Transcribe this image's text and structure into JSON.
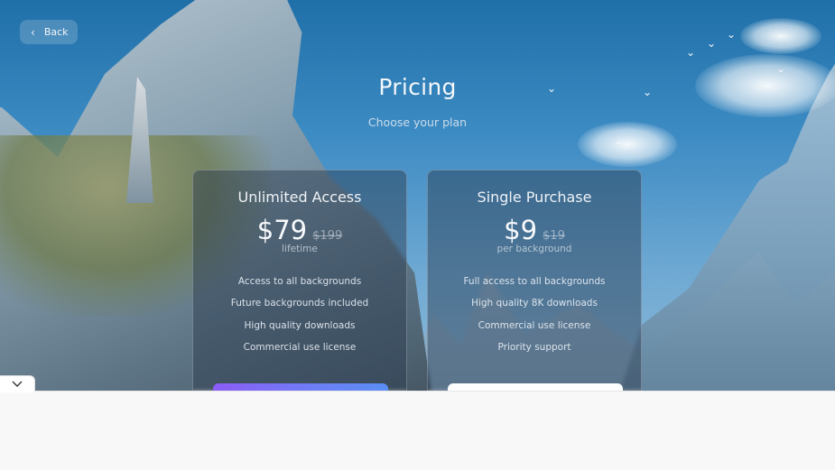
{
  "nav": {
    "back_label": "Back"
  },
  "header": {
    "title": "Pricing",
    "subtitle": "Choose your plan"
  },
  "plans": [
    {
      "name": "Unlimited Access",
      "price": "$79",
      "old_price": "$199",
      "period": "lifetime",
      "features": [
        "Access to all backgrounds",
        "Future backgrounds included",
        "High quality downloads",
        "Commercial use license"
      ],
      "button_style": "purple"
    },
    {
      "name": "Single Purchase",
      "price": "$9",
      "old_price": "$19",
      "period": "per background",
      "features": [
        "Full access to all backgrounds",
        "High quality 8K downloads",
        "Commercial use license",
        "Priority support"
      ],
      "button_style": "white"
    }
  ],
  "icons": {
    "back": "chevron-left-icon",
    "collapse": "chevron-down-icon"
  },
  "colors": {
    "accent_start": "#8b5cf6",
    "accent_end": "#5a8ef5"
  }
}
